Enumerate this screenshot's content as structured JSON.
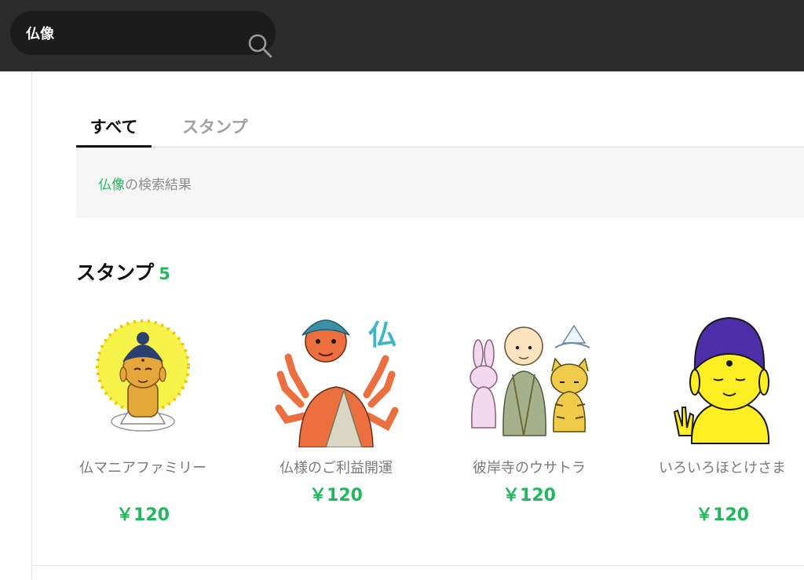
{
  "search": {
    "value": "仏像",
    "placeholder": ""
  },
  "tabs": [
    {
      "label": "すべて",
      "active": true
    },
    {
      "label": "スタンプ",
      "active": false
    }
  ],
  "result": {
    "term": "仏像",
    "suffix": "の検索結果"
  },
  "section": {
    "title": "スタンプ",
    "count": "5"
  },
  "items": [
    {
      "name": "仏マニアファミリー",
      "price": "￥120",
      "image": "buddha-on-lotus-sticker"
    },
    {
      "name": "仏様のご利益開運",
      "price": "￥120",
      "image": "six-armed-deity-sticker"
    },
    {
      "name": "彼岸寺のウサトラ",
      "price": "￥120",
      "image": "monk-rabbit-tiger-sticker"
    },
    {
      "name": "いろいろほとけさま",
      "price": "￥120",
      "image": "yellow-purple-buddha-sticker"
    }
  ],
  "colors": {
    "accent": "#1fb85a",
    "header": "#2b2b2b"
  }
}
